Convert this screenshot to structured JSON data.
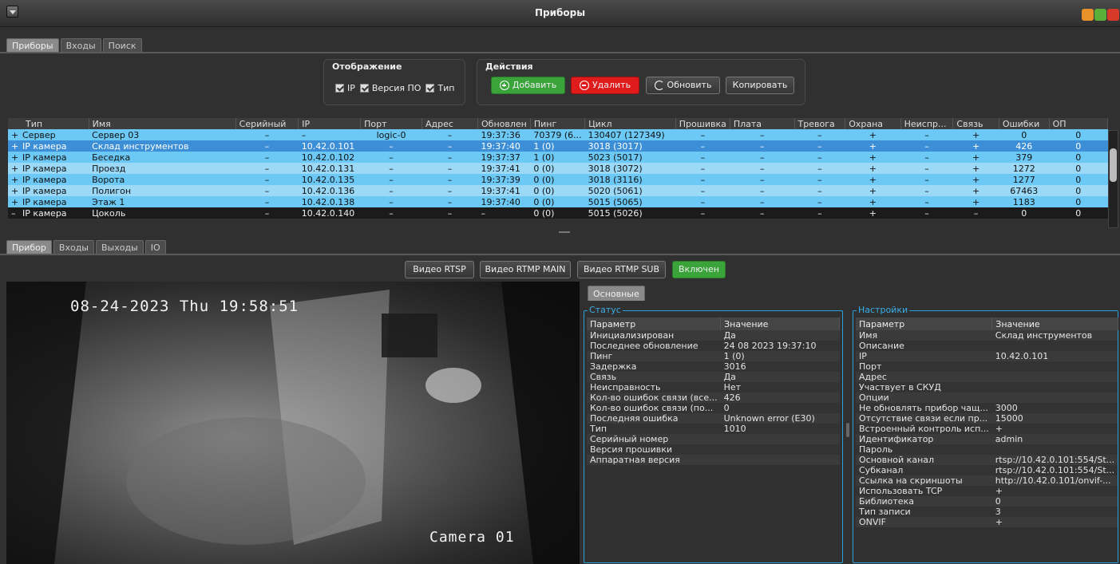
{
  "window": {
    "title": "Приборы"
  },
  "top_tabs": [
    "Приборы",
    "Входы",
    "Поиск"
  ],
  "display_group": {
    "title": "Отображение",
    "checks": [
      "IP",
      "Версия ПО",
      "Тип"
    ]
  },
  "actions_group": {
    "title": "Действия",
    "add": "Добавить",
    "delete": "Удалить",
    "refresh": "Обновить",
    "copy": "Копировать"
  },
  "devices": {
    "columns": [
      "Тип",
      "Имя",
      "Серийный",
      "IP",
      "Порт",
      "Адрес",
      "Обновлен",
      "Пинг",
      "Цикл",
      "Прошивка",
      "Плата",
      "Тревога",
      "Охрана",
      "Неиспр...",
      "Связь",
      "Ошибки",
      "ОП"
    ],
    "rows": [
      {
        "exp": "+",
        "type": "Сервер",
        "name": "Сервер 03",
        "serial": "–",
        "ip": "–",
        "port": "logic-0",
        "addr": "–",
        "updated": "19:37:36",
        "ping": "70379 (6...",
        "cycle": "130407 (127349)",
        "fw": "–",
        "board": "–",
        "alarm": "–",
        "guard": "+",
        "fault": "–",
        "link": "+",
        "errors": "0",
        "op": "0"
      },
      {
        "exp": "+",
        "type": "IP камера",
        "name": "Склад инструментов",
        "serial": "–",
        "ip": "10.42.0.101",
        "port": "–",
        "addr": "–",
        "updated": "19:37:40",
        "ping": "1 (0)",
        "cycle": "3018 (3017)",
        "fw": "–",
        "board": "–",
        "alarm": "–",
        "guard": "+",
        "fault": "–",
        "link": "+",
        "errors": "426",
        "op": "0"
      },
      {
        "exp": "+",
        "type": "IP камера",
        "name": "Беседка",
        "serial": "–",
        "ip": "10.42.0.102",
        "port": "–",
        "addr": "–",
        "updated": "19:37:37",
        "ping": "1 (0)",
        "cycle": "5023 (5017)",
        "fw": "–",
        "board": "–",
        "alarm": "–",
        "guard": "+",
        "fault": "–",
        "link": "+",
        "errors": "379",
        "op": "0"
      },
      {
        "exp": "+",
        "type": "IP камера",
        "name": "Проезд",
        "serial": "–",
        "ip": "10.42.0.131",
        "port": "–",
        "addr": "–",
        "updated": "19:37:41",
        "ping": "0 (0)",
        "cycle": "3018 (3072)",
        "fw": "–",
        "board": "–",
        "alarm": "–",
        "guard": "+",
        "fault": "–",
        "link": "+",
        "errors": "1272",
        "op": "0"
      },
      {
        "exp": "+",
        "type": "IP камера",
        "name": "Ворота",
        "serial": "–",
        "ip": "10.42.0.135",
        "port": "–",
        "addr": "–",
        "updated": "19:37:39",
        "ping": "0 (0)",
        "cycle": "3018 (3116)",
        "fw": "–",
        "board": "–",
        "alarm": "–",
        "guard": "+",
        "fault": "–",
        "link": "+",
        "errors": "1277",
        "op": "0"
      },
      {
        "exp": "+",
        "type": "IP камера",
        "name": "Полигон",
        "serial": "–",
        "ip": "10.42.0.136",
        "port": "–",
        "addr": "–",
        "updated": "19:37:41",
        "ping": "0 (0)",
        "cycle": "5020 (5061)",
        "fw": "–",
        "board": "–",
        "alarm": "–",
        "guard": "+",
        "fault": "–",
        "link": "+",
        "errors": "67463",
        "op": "0"
      },
      {
        "exp": "+",
        "type": "IP камера",
        "name": "Этаж 1",
        "serial": "–",
        "ip": "10.42.0.138",
        "port": "–",
        "addr": "–",
        "updated": "19:37:40",
        "ping": "0 (0)",
        "cycle": "5015 (5065)",
        "fw": "–",
        "board": "–",
        "alarm": "–",
        "guard": "+",
        "fault": "–",
        "link": "+",
        "errors": "1183",
        "op": "0"
      },
      {
        "exp": "–",
        "type": "IP камера",
        "name": "Цоколь",
        "serial": "–",
        "ip": "10.42.0.140",
        "port": "–",
        "addr": "–",
        "updated": "–",
        "ping": "0 (0)",
        "cycle": "5015 (5026)",
        "fw": "–",
        "board": "–",
        "alarm": "–",
        "guard": "+",
        "fault": "–",
        "link": "–",
        "errors": "0",
        "op": "0"
      }
    ]
  },
  "bottom_tabs": [
    "Прибор",
    "Входы",
    "Выходы",
    "IO"
  ],
  "video_buttons": [
    "Видео RTSP",
    "Видео RTMP MAIN",
    "Видео RTMP SUB",
    "Включен"
  ],
  "video": {
    "timestamp": "08-24-2023 Thu 19:58:51",
    "camera": "Camera 01"
  },
  "info_tab": "Основные",
  "status": {
    "legend": "Статус",
    "headers": [
      "Параметр",
      "Значение"
    ],
    "rows": [
      [
        "Инициализирован",
        "Да"
      ],
      [
        "Последнее обновление",
        "24 08 2023 19:37:10"
      ],
      [
        "Пинг",
        "1 (0)"
      ],
      [
        "Задержка",
        "3016"
      ],
      [
        "Связь",
        "Да"
      ],
      [
        "Неисправность",
        "Нет"
      ],
      [
        "Кол-во ошибок связи (все...",
        "426"
      ],
      [
        "Кол-во ошибок связи (по...",
        "0"
      ],
      [
        "Последняя ошибка",
        "Unknown error (E30)"
      ],
      [
        "Тип",
        "1010"
      ],
      [
        "Серийный номер",
        ""
      ],
      [
        "Версия прошивки",
        ""
      ],
      [
        "Аппаратная версия",
        ""
      ]
    ]
  },
  "settings": {
    "legend": "Настройки",
    "headers": [
      "Параметр",
      "Значение"
    ],
    "rows": [
      [
        "Имя",
        "Склад инструментов"
      ],
      [
        "Описание",
        ""
      ],
      [
        "IP",
        "10.42.0.101"
      ],
      [
        "Порт",
        ""
      ],
      [
        "Адрес",
        ""
      ],
      [
        "Участвует в СКУД",
        ""
      ],
      [
        "Опции",
        ""
      ],
      [
        "Не обновлять прибор чащ...",
        "3000"
      ],
      [
        "Отсутствие связи если пр...",
        "15000"
      ],
      [
        "Встроенный контроль исп...",
        "+"
      ],
      [
        "Идентификатор",
        "admin"
      ],
      [
        "Пароль",
        ""
      ],
      [
        "Основной канал",
        "rtsp://10.42.0.101:554/St..."
      ],
      [
        "Субканал",
        "rtsp://10.42.0.101:554/St..."
      ],
      [
        "Ссылка на скриншоты",
        "http://10.42.0.101/onvif-..."
      ],
      [
        "Использовать TCP",
        "+"
      ],
      [
        "Библиотека",
        "0"
      ],
      [
        "Тип записи",
        "3"
      ],
      [
        "ONVIF",
        "+"
      ]
    ]
  },
  "colors": {
    "accent": "#2aa0d8",
    "selected_row": "#3c8fd6",
    "row_even": "#6cc8f4",
    "row_odd": "#9bd9f7",
    "add_green": "#3aa43a",
    "delete_red": "#e01b1b"
  }
}
